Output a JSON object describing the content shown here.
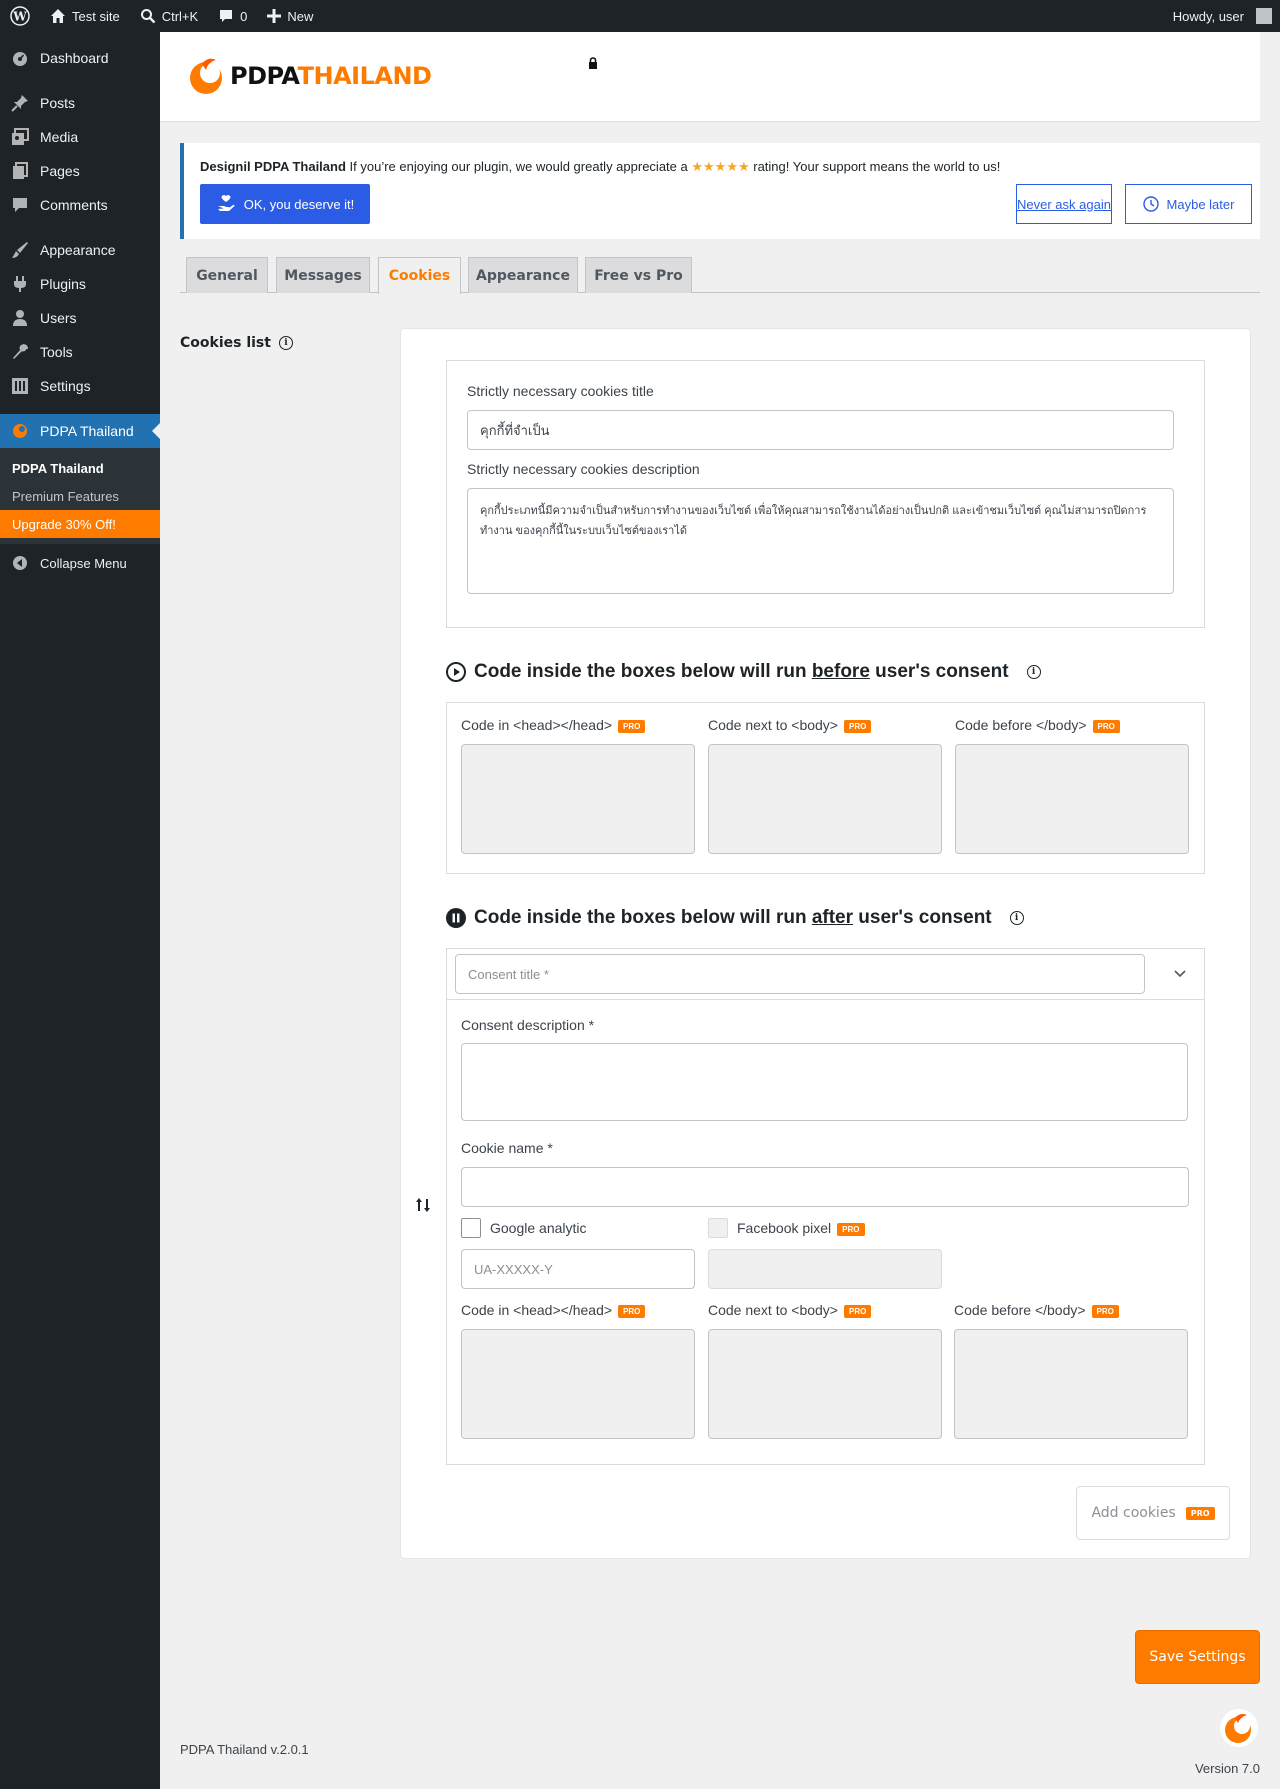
{
  "adminbar": {
    "site_name": "Test site",
    "search_shortcut": "Ctrl+K",
    "comments_count": "0",
    "new_label": "New",
    "howdy": "Howdy, user"
  },
  "sidebar": {
    "items": [
      {
        "label": "Dashboard",
        "icon": "dashboard-icon"
      },
      {
        "label": "Posts",
        "icon": "pin-icon"
      },
      {
        "label": "Media",
        "icon": "media-icon"
      },
      {
        "label": "Pages",
        "icon": "pages-icon"
      },
      {
        "label": "Comments",
        "icon": "comment-icon"
      },
      {
        "label": "Appearance",
        "icon": "brush-icon"
      },
      {
        "label": "Plugins",
        "icon": "plugin-icon"
      },
      {
        "label": "Users",
        "icon": "user-icon"
      },
      {
        "label": "Tools",
        "icon": "wrench-icon"
      },
      {
        "label": "Settings",
        "icon": "settings-icon"
      },
      {
        "label": "PDPA Thailand",
        "icon": "pdpa-icon"
      }
    ],
    "submenu": [
      "PDPA Thailand",
      "Premium Features",
      "Upgrade 30% Off!"
    ],
    "collapse": "Collapse Menu"
  },
  "header": {
    "logo_part1": "PDPA",
    "logo_part2": "THAILAND"
  },
  "notice": {
    "plugin_name": "Designil PDPA Thailand",
    "text_before": " If you’re enjoying our plugin, we would greatly appreciate a ",
    "stars": "★★★★★",
    "text_after": " rating! Your support means the world to us!",
    "ok_button": "OK, you deserve it!",
    "never_button": "Never ask again",
    "later_button": "Maybe later"
  },
  "tabs": [
    "General",
    "Messages",
    "Cookies",
    "Appearance",
    "Free vs Pro"
  ],
  "section": {
    "label": "Cookies list"
  },
  "necessary": {
    "title_label": "Strictly necessary cookies title",
    "title_value": "คุกกี้ที่จำเป็น",
    "desc_label": "Strictly necessary cookies description",
    "desc_value": "คุกกี้ประเภทนี้มีความจำเป็นสำหรับการทำงานของเว็บไซต์ เพื่อให้คุณสามารถใช้งานได้อย่างเป็นปกติ และเข้าชมเว็บไซต์ คุณไม่สามารถปิดการทำงาน ของคุกกี้นี้ในระบบเว็บไซต์ของเราได้"
  },
  "before": {
    "heading_pre": "Code inside the boxes below will run ",
    "heading_em": "before",
    "heading_post": " user's consent",
    "head_label": "Code in <head></head>",
    "body_open_label": "Code next to <body>",
    "body_close_label": "Code before </body>"
  },
  "after": {
    "heading_pre": "Code inside the boxes below will run ",
    "heading_em": "after",
    "heading_post": " user's consent",
    "consent_title_placeholder": "Consent title *",
    "consent_desc_label": "Consent description *",
    "cookie_name_label": "Cookie name *",
    "google_label": "Google analytic",
    "google_placeholder": "UA-XXXXX-Y",
    "facebook_label": "Facebook pixel",
    "head_label": "Code in <head></head>",
    "body_open_label": "Code next to <body>",
    "body_close_label": "Code before </body>"
  },
  "pro_badge": "PRO",
  "add_cookies": "Add cookies",
  "save_settings": "Save Settings",
  "footer": {
    "plugin_version": "PDPA Thailand v.2.0.1",
    "wp_version": "Version 7.0"
  },
  "colors": {
    "accent": "#ff7b00",
    "primary_blue": "#2b5ce6",
    "admin_dark": "#1d2327"
  }
}
